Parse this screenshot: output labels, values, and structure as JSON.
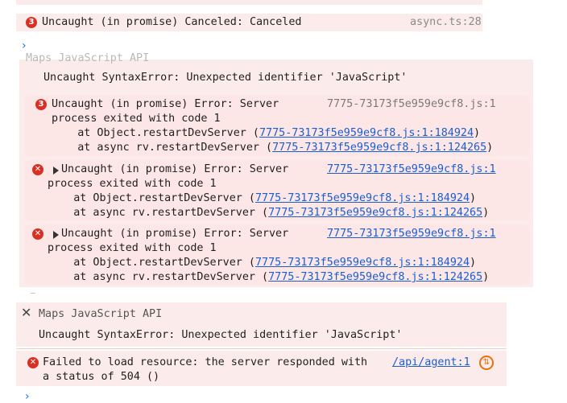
{
  "entries": [
    {
      "count": "3",
      "message": "Uncaught (in promise) Canceled: Canceled",
      "source": "async.ts:28"
    },
    {
      "title": "Maps JavaScript API",
      "message": "Uncaught SyntaxError: Unexpected identifier 'JavaScript'"
    },
    {
      "count": "3",
      "lines": [
        "Uncaught (in promise) Error: Server",
        "process exited with code 1",
        "    at Object.restartDevServer (",
        "    at async rv.restartDevServer ("
      ],
      "source": "7775-73173f5e959e9cf8.js:1",
      "link1": "7775-73173f5e959e9cf8.js:1:184924",
      "link2": "7775-73173f5e959e9cf8.js:1:124265",
      "close": ")"
    },
    {
      "lines": [
        "Uncaught (in promise) Error: Server",
        "process exited with code 1",
        "    at Object.restartDevServer (",
        "    at async rv.restartDevServer ("
      ],
      "source": "7775-73173f5e959e9cf8.js:1",
      "link1": "7775-73173f5e959e9cf8.js:1:184924",
      "link2": "7775-73173f5e959e9cf8.js:1:124265",
      "close": ")"
    },
    {
      "lines": [
        "Uncaught (in promise) Error: Server",
        "process exited with code 1",
        "    at Object.restartDevServer (",
        "    at async rv.restartDevServer ("
      ],
      "source": "7775-73173f5e959e9cf8.js:1",
      "link1": "7775-73173f5e959e9cf8.js:1:184924",
      "link2": "7775-73173f5e959e9cf8.js:1:124265",
      "close": ")"
    },
    {
      "title": "Maps JavaScript API",
      "message": "Uncaught SyntaxError: Unexpected identifier 'JavaScript'"
    },
    {
      "lines": [
        "Failed to load resource: the server responded with",
        "a status of 504 ()"
      ],
      "source": "/api/agent:1"
    }
  ],
  "icons": {
    "error": "error-icon",
    "expand": "expand-triangle-icon",
    "close": "close-icon",
    "prompt": "chevron-right-icon",
    "network": "network-request-icon"
  },
  "colors": {
    "error_red": "#d93025",
    "error_bg": "#fcebeb",
    "link": "#1a5fd0"
  }
}
